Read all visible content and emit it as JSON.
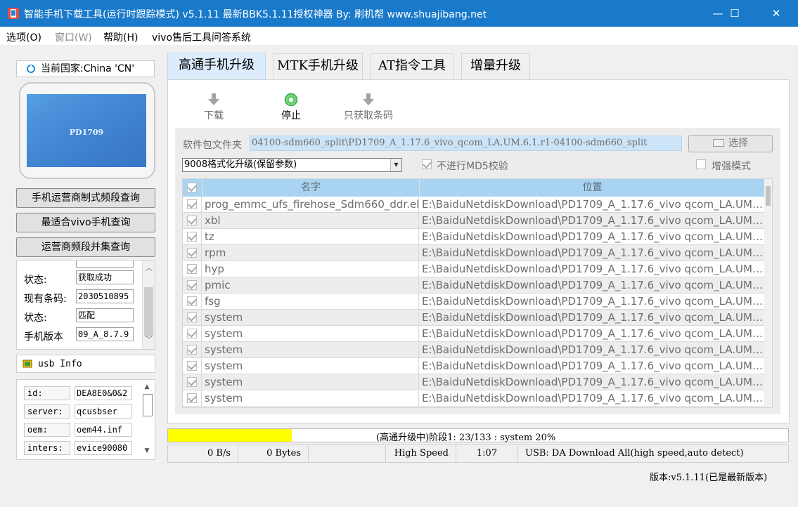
{
  "window": {
    "title": "智能手机下载工具(运行时跟踪模式) v5.1.11 最新BBK5.1.11授权神器 By: 刷机帮 www.shuajibang.net",
    "controls": {
      "minimize": "—",
      "maximize": "☐",
      "close": "✕"
    }
  },
  "menu": {
    "items": [
      "选项(O)",
      "窗口(W)",
      "帮助(H)",
      "vivo售后工具问答系统"
    ]
  },
  "left": {
    "country": "当前国家:China 'CN'",
    "phone_model": "PD1709",
    "buttons": [
      "手机运营商制式频段查询",
      "最适合vivo手机查询",
      "运营商频段并集查询"
    ],
    "info_rows": [
      {
        "label": "状态:",
        "value": "获取成功"
      },
      {
        "label": "现有条码:",
        "value": "2030510895"
      },
      {
        "label": "状态:",
        "value": "匹配"
      },
      {
        "label": "手机版本",
        "value": "09_A_8.7.9"
      }
    ],
    "usb_title": "usb Info",
    "usb_rows": [
      {
        "label": "id:",
        "value": "DEA8E0&0&2"
      },
      {
        "label": "server:",
        "value": "qcusbser"
      },
      {
        "label": "oem:",
        "value": "oem44.inf"
      },
      {
        "label": "inters:",
        "value": "evice90080"
      }
    ]
  },
  "tabs": [
    "高通手机升级",
    "MTK手机升级",
    "AT指令工具",
    "增量升级"
  ],
  "toolbar": {
    "download": "下载",
    "stop": "停止",
    "barcode_only": "只获取条码"
  },
  "package": {
    "label": "软件包文件夹",
    "path": "04100-sdm660_split\\PD1709_A_1.17.6_vivo_qcom_LA.UM.6.1.r1-04100-sdm660_split",
    "select_button": "选择",
    "mode": "9008格式化升级(保留参数)",
    "skip_md5": "不进行MD5校验",
    "enhanced_mode": "增强模式"
  },
  "grid": {
    "headers": [
      "名字",
      "位置"
    ],
    "rows": [
      {
        "name": "prog_emmc_ufs_firehose_Sdm660_ddr.elf",
        "location": "E:\\BaiduNetdiskDownload\\PD1709_A_1.17.6_vivo qcom_LA.UM.6..."
      },
      {
        "name": "xbl",
        "location": "E:\\BaiduNetdiskDownload\\PD1709_A_1.17.6_vivo qcom_LA.UM.6..."
      },
      {
        "name": "tz",
        "location": "E:\\BaiduNetdiskDownload\\PD1709_A_1.17.6_vivo qcom_LA.UM.6..."
      },
      {
        "name": "rpm",
        "location": "E:\\BaiduNetdiskDownload\\PD1709_A_1.17.6_vivo qcom_LA.UM.6..."
      },
      {
        "name": "hyp",
        "location": "E:\\BaiduNetdiskDownload\\PD1709_A_1.17.6_vivo qcom_LA.UM.6..."
      },
      {
        "name": "pmic",
        "location": "E:\\BaiduNetdiskDownload\\PD1709_A_1.17.6_vivo qcom_LA.UM.6..."
      },
      {
        "name": "fsg",
        "location": "E:\\BaiduNetdiskDownload\\PD1709_A_1.17.6_vivo qcom_LA.UM.6..."
      },
      {
        "name": "system",
        "location": "E:\\BaiduNetdiskDownload\\PD1709_A_1.17.6_vivo qcom_LA.UM.6..."
      },
      {
        "name": "system",
        "location": "E:\\BaiduNetdiskDownload\\PD1709_A_1.17.6_vivo qcom_LA.UM.6..."
      },
      {
        "name": "system",
        "location": "E:\\BaiduNetdiskDownload\\PD1709_A_1.17.6_vivo qcom_LA.UM.6..."
      },
      {
        "name": "system",
        "location": "E:\\BaiduNetdiskDownload\\PD1709_A_1.17.6_vivo qcom_LA.UM.6..."
      },
      {
        "name": "system",
        "location": "E:\\BaiduNetdiskDownload\\PD1709_A_1.17.6_vivo qcom_LA.UM.6..."
      },
      {
        "name": "system",
        "location": "E:\\BaiduNetdiskDownload\\PD1709_A_1.17.6_vivo qcom_LA.UM.6..."
      }
    ]
  },
  "progress": {
    "fraction": 0.2,
    "text": "(高通升级中)阶段1: 23/133 : system 20%"
  },
  "status": {
    "speed": "0 B/s",
    "bytes": "0 Bytes",
    "mode": "High Speed",
    "time": "1:07",
    "usb": "USB: DA Download All(high speed,auto detect)"
  },
  "version": "版本:v5.1.11(已是最新版本)",
  "colors": {
    "titlebar": "#1979ca",
    "progress_fill": "#ffff00",
    "grid_header": "#a8d4f2",
    "active_tab": "#dcecfc",
    "stop_icon": "#2ab24a"
  }
}
